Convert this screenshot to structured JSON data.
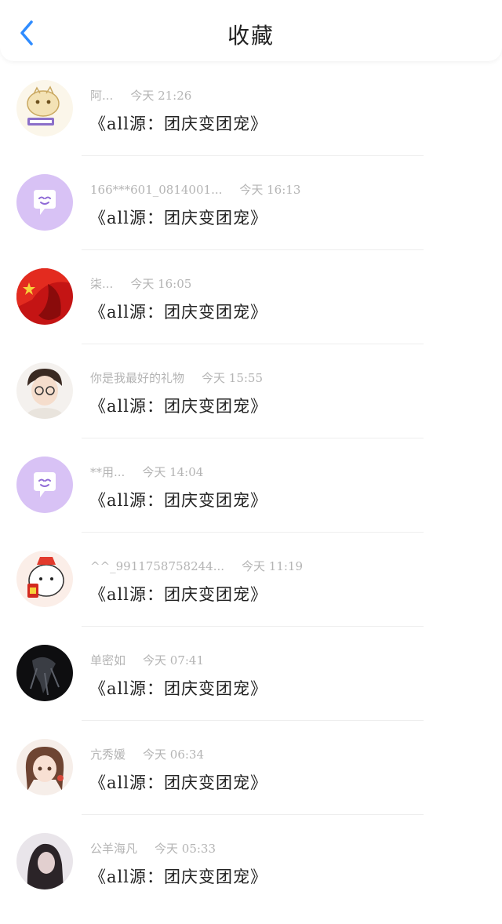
{
  "header": {
    "title": "收藏",
    "back_icon": "chevron-left-icon",
    "accent_color": "#2f8cff"
  },
  "items": [
    {
      "name": "阿...",
      "time": "今天 21:26",
      "message": "《all源：团庆变团宠》",
      "avatar": "tiger-sticker"
    },
    {
      "name": "166***601_0814001...",
      "time": "今天 16:13",
      "message": "《all源：团庆变团宠》",
      "avatar": "default-chat-bubble"
    },
    {
      "name": "柒...",
      "time": "今天 16:05",
      "message": "《all源：团庆变团宠》",
      "avatar": "red-portrait"
    },
    {
      "name": "你是我最好的礼物",
      "time": "今天 15:55",
      "message": "《all源：团庆变团宠》",
      "avatar": "glasses-boy"
    },
    {
      "name": "**用...",
      "time": "今天 14:04",
      "message": "《all源：团庆变团宠》",
      "avatar": "default-chat-bubble"
    },
    {
      "name": "^^_9911758758244...",
      "time": "今天 11:19",
      "message": "《all源：团庆变团宠》",
      "avatar": "bear-sticker"
    },
    {
      "name": "单密如",
      "time": "今天 07:41",
      "message": "《all源：团庆变团宠》",
      "avatar": "dark-portrait"
    },
    {
      "name": "亢秀媛",
      "time": "今天 06:34",
      "message": "《all源：团庆变团宠》",
      "avatar": "anime-girl"
    },
    {
      "name": "公羊海凡",
      "time": "今天 05:33",
      "message": "《all源：团庆变团宠》",
      "avatar": "girl-photo"
    }
  ],
  "colors": {
    "default_avatar_bg": "#d8c2f5",
    "meta_text": "#b4b4b4",
    "message_text": "#222222"
  }
}
